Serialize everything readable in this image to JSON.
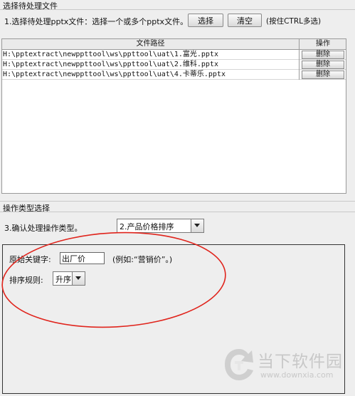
{
  "file_section": {
    "title": "选择待处理文件",
    "prompt": "1.选择待处理pptx文件：选择一个或多个pptx文件。",
    "select_label": "选择",
    "clear_label": "清空",
    "hint": "(按住CTRL多选)"
  },
  "table": {
    "headers": [
      "文件路径",
      "操作"
    ],
    "rows": [
      {
        "path": "H:\\pptextract\\newppttool\\ws\\ppttool\\uat\\1.富光.pptx",
        "action": "删除"
      },
      {
        "path": "H:\\pptextract\\newppttool\\ws\\ppttool\\uat\\2.维科.pptx",
        "action": "删除"
      },
      {
        "path": "H:\\pptextract\\newppttool\\ws\\ppttool\\uat\\4.卡蒂乐.pptx",
        "action": "删除"
      }
    ]
  },
  "op_section": {
    "title": "操作类型选择",
    "prompt": "3.确认处理操作类型。",
    "selected_type": "2.产品价格排序"
  },
  "detail": {
    "keyword_label": "原始关键字:",
    "keyword_value": "出厂价",
    "keyword_example": "(例如:“营销价”。)",
    "sort_label": "排序规则:",
    "sort_value": "升序"
  },
  "watermark": {
    "brand": "当下软件园",
    "url": "www.downxia.com"
  },
  "colors": {
    "annotation_circle": "#e0241c",
    "watermark": "#c8c8c8"
  }
}
